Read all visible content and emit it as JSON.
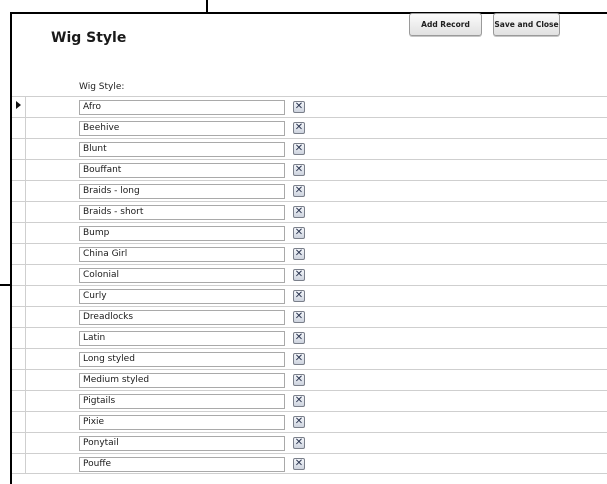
{
  "header": {
    "title": "Wig Style",
    "add_record_label": "Add Record",
    "save_close_label": "Save and Close"
  },
  "column_header": "Wig Style:",
  "delete_glyph": "✕",
  "rows": [
    {
      "value": "Afro",
      "current": true
    },
    {
      "value": "Beehive"
    },
    {
      "value": "Blunt"
    },
    {
      "value": "Bouffant"
    },
    {
      "value": "Braids - long"
    },
    {
      "value": "Braids - short"
    },
    {
      "value": "Bump"
    },
    {
      "value": "China Girl"
    },
    {
      "value": "Colonial"
    },
    {
      "value": "Curly"
    },
    {
      "value": "Dreadlocks"
    },
    {
      "value": "Latin"
    },
    {
      "value": "Long styled"
    },
    {
      "value": "Medium styled"
    },
    {
      "value": "Pigtails"
    },
    {
      "value": "Pixie"
    },
    {
      "value": "Ponytail"
    },
    {
      "value": "Pouffe"
    }
  ]
}
